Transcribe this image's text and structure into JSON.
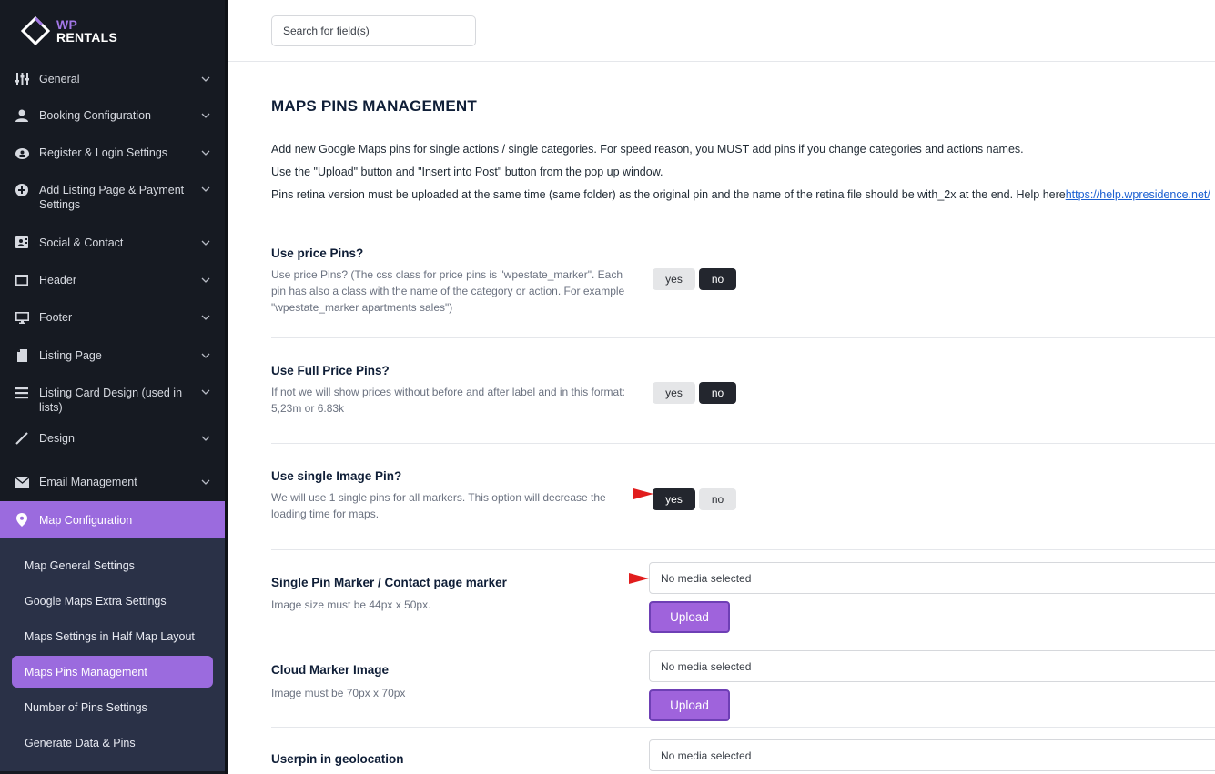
{
  "brand": {
    "line1": "WP",
    "line2": "RENTALS"
  },
  "search": {
    "placeholder": "Search for field(s)"
  },
  "sidebar": {
    "items": [
      {
        "label": "General",
        "icon": "sliders-icon"
      },
      {
        "label": "Booking Configuration",
        "icon": "user-icon"
      },
      {
        "label": "Register & Login Settings",
        "icon": "login-icon"
      },
      {
        "label": "Add Listing Page & Payment Settings",
        "icon": "plus-circle-icon"
      },
      {
        "label": "Social & Contact",
        "icon": "contact-card-icon"
      },
      {
        "label": "Header",
        "icon": "header-icon"
      },
      {
        "label": "Footer",
        "icon": "monitor-icon"
      },
      {
        "label": "Listing Page",
        "icon": "document-icon"
      },
      {
        "label": "Listing Card Design (used in lists)",
        "icon": "list-icon"
      },
      {
        "label": "Design",
        "icon": "brush-icon"
      },
      {
        "label": "Email Management",
        "icon": "envelope-icon"
      },
      {
        "label": "Map Configuration",
        "icon": "map-pin-icon"
      }
    ],
    "submenu": [
      "Map General Settings",
      "Google Maps Extra Settings",
      "Maps Settings in Half Map Layout",
      "Maps Pins Management",
      "Number of Pins Settings",
      "Generate Data & Pins"
    ]
  },
  "page": {
    "title": "MAPS PINS MANAGEMENT",
    "desc1": "Add new Google Maps pins for single actions / single categories. For speed reason, you MUST add pins if you change categories and actions names.",
    "desc2": "Use the \"Upload\" button and \"Insert into Post\" button from the pop up window.",
    "desc3": "Pins retina version must be uploaded at the same time (same folder) as the original pin and the name of the retina file should be with_2x at the end. Help here",
    "help_link": "https://help.wpresidence.net/"
  },
  "toggle_labels": {
    "yes": "yes",
    "no": "no"
  },
  "settings": {
    "price_pins": {
      "title": "Use price Pins?",
      "desc": "Use price Pins? (The css class for price pins is \"wpestate_marker\". Each pin has also a class with the name of the category or action. For example \"wpestate_marker apartments sales\")",
      "value": "no"
    },
    "full_price_pins": {
      "title": "Use Full Price Pins?",
      "desc": "If not we will show prices without before and after label and in this format: 5,23m or 6.83k",
      "value": "no"
    },
    "single_image_pin": {
      "title": "Use single Image Pin?",
      "desc": "We will use 1 single pins for all markers. This option will decrease the loading time for maps.",
      "value": "yes"
    },
    "single_pin_marker": {
      "title": "Single Pin Marker / Contact page marker",
      "desc": "Image size must be 44px x 50px.",
      "media": "No media selected",
      "button": "Upload"
    },
    "cloud_marker": {
      "title": "Cloud Marker Image",
      "desc": "Image must be 70px x 70px",
      "media": "No media selected",
      "button": "Upload"
    },
    "userpin": {
      "title": "Userpin in geolocation",
      "media": "No media selected"
    }
  },
  "colors": {
    "accent": "#9b6bde",
    "sidebar_bg": "#161a22",
    "submenu_bg": "#2a3147",
    "arrow": "#e11d1d"
  }
}
